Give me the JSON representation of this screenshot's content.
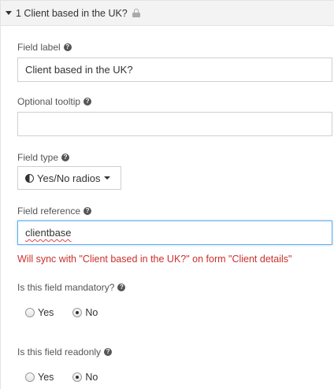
{
  "header": {
    "title": "1 Client based in the UK?"
  },
  "field_label": {
    "label": "Field label",
    "value": "Client based in the UK?"
  },
  "optional_tooltip": {
    "label": "Optional tooltip",
    "value": ""
  },
  "field_type": {
    "label": "Field type",
    "selected": "Yes/No radios"
  },
  "field_reference": {
    "label": "Field reference",
    "value": "clientbase",
    "sync_message": "Will sync with \"Client based in the UK?\" on form \"Client details\""
  },
  "mandatory": {
    "label": "Is this field mandatory?",
    "options": [
      "Yes",
      "No"
    ],
    "selected": "No"
  },
  "readonly": {
    "label": "Is this field readonly",
    "options": [
      "Yes",
      "No"
    ],
    "selected": "No"
  },
  "colors": {
    "error": "#c9302c",
    "focus_border": "#66afe9",
    "header_bg": "#f3f3f3"
  }
}
